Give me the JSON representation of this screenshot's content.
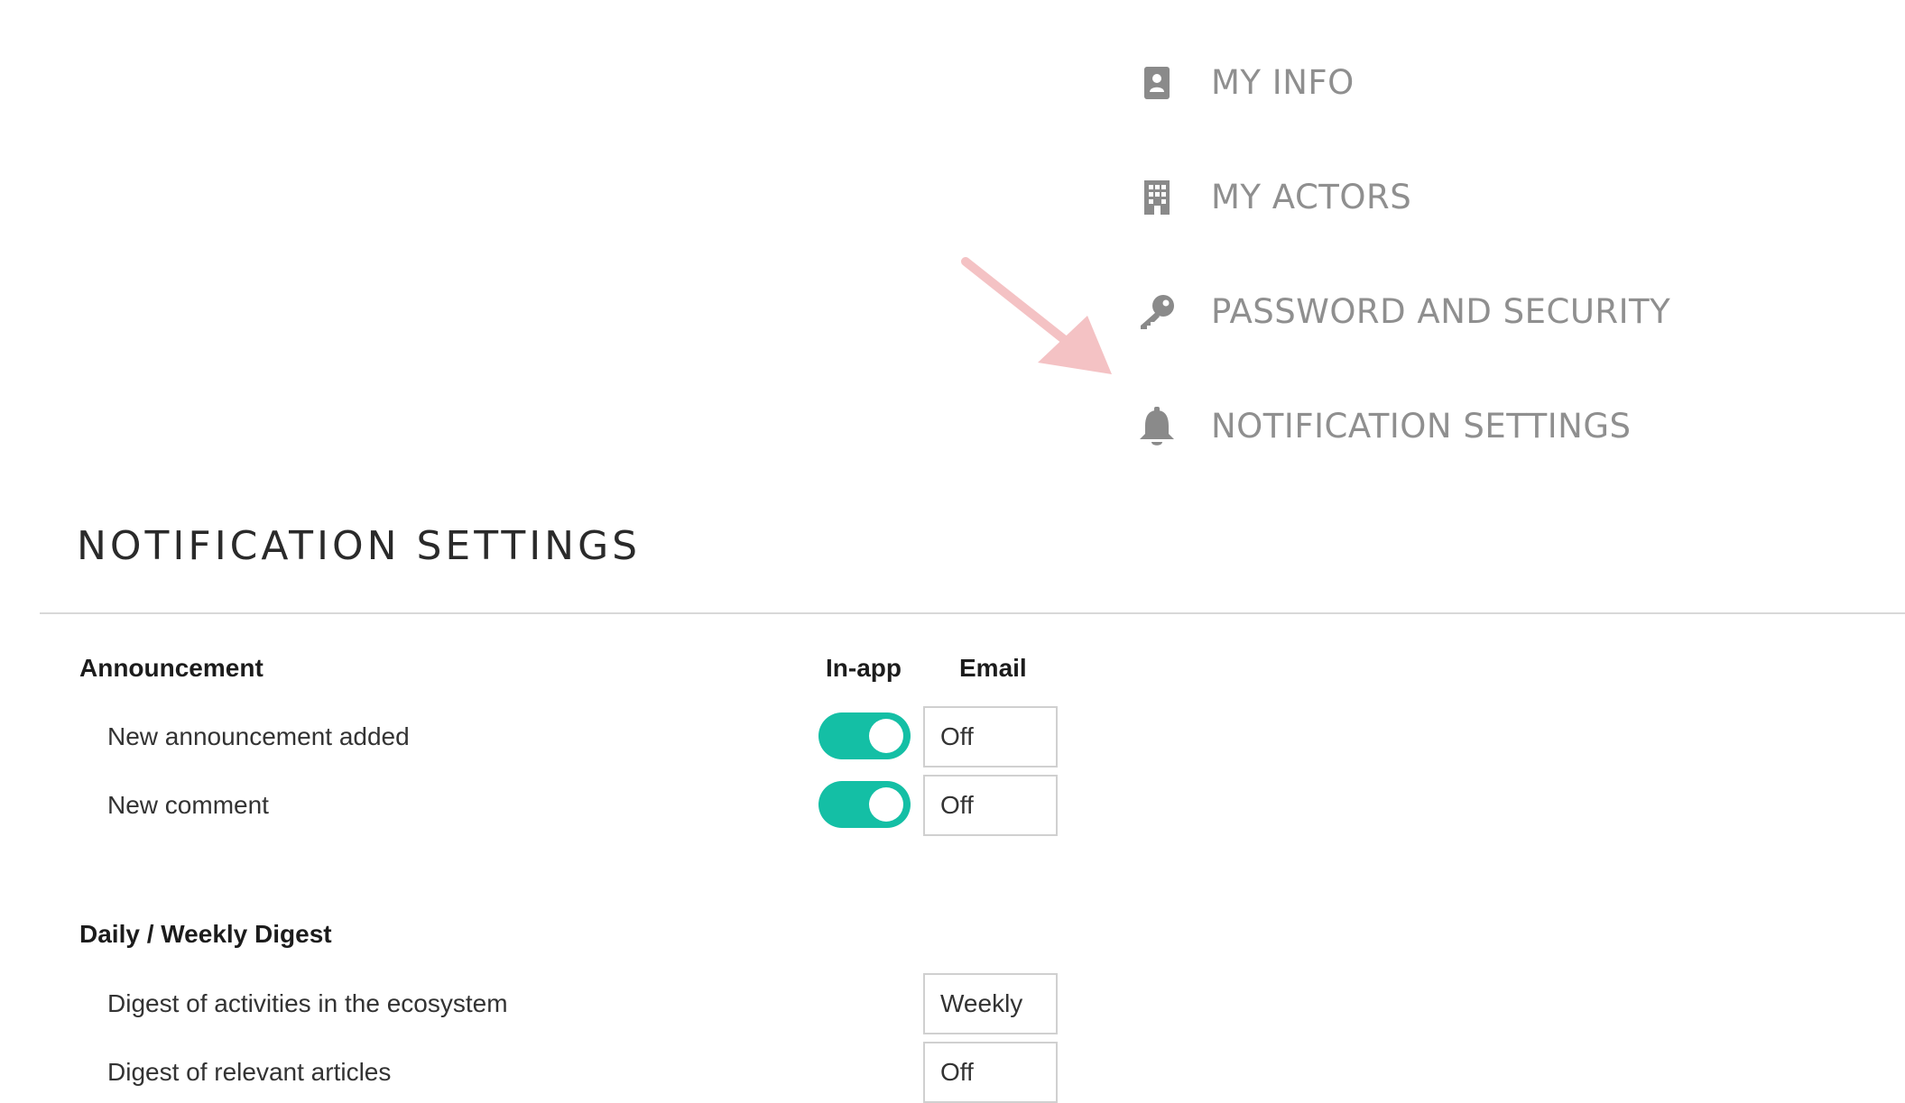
{
  "menu": {
    "items": [
      {
        "label": "MY INFO",
        "icon": "contact-card-icon"
      },
      {
        "label": "MY ACTORS",
        "icon": "building-icon"
      },
      {
        "label": "PASSWORD AND SECURITY",
        "icon": "key-icon"
      },
      {
        "label": "NOTIFICATION SETTINGS",
        "icon": "bell-icon"
      }
    ]
  },
  "annotation": {
    "icon": "pointer-arrow-icon",
    "color": "#f4c2c4"
  },
  "page": {
    "title": "NOTIFICATION SETTINGS"
  },
  "columns": {
    "inapp": "In-app",
    "email": "Email"
  },
  "groups": [
    {
      "title": "Announcement",
      "rows": [
        {
          "label": "New announcement added",
          "inapp_enabled": true,
          "email": "Off"
        },
        {
          "label": "New comment",
          "inapp_enabled": true,
          "email": "Off"
        }
      ]
    },
    {
      "title": "Daily / Weekly Digest",
      "rows": [
        {
          "label": "Digest of activities in the ecosystem",
          "email": "Weekly"
        },
        {
          "label": "Digest of relevant articles",
          "email": "Off"
        }
      ]
    }
  ],
  "colors": {
    "accent": "#14bfa5",
    "menu_text": "#8f8f8f",
    "icon": "#8a8a8a"
  }
}
